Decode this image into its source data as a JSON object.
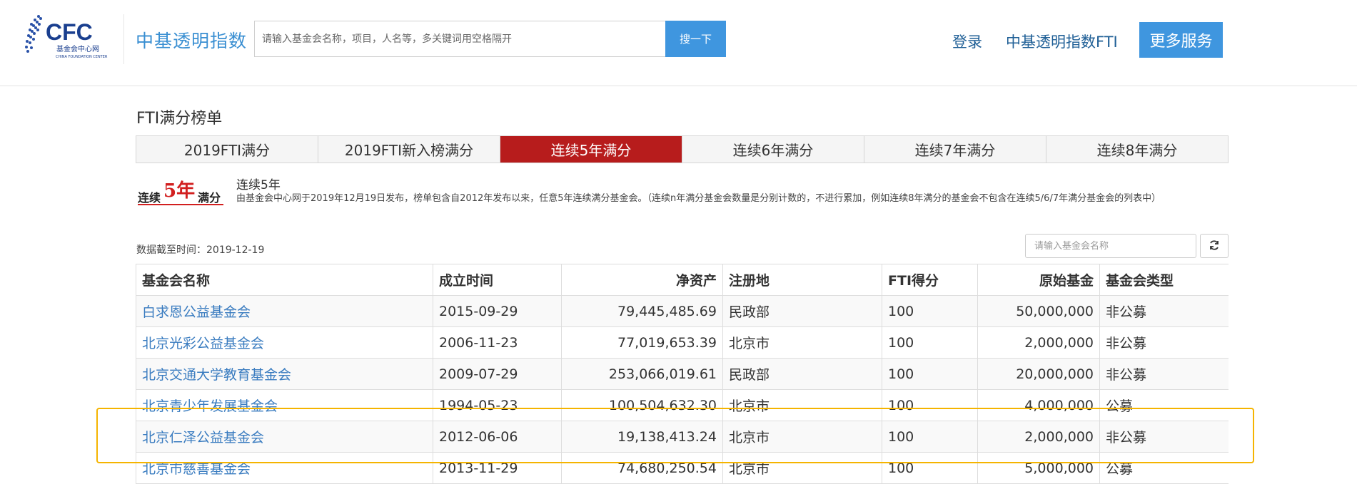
{
  "header": {
    "logo": {
      "main": "CFC",
      "sub_cn": "基金会中心网",
      "sub_en": "CHINA FOUNDATION CENTER",
      "color": "#1a3f8f"
    },
    "brand": "中基透明指数",
    "search": {
      "placeholder": "请输入基金会名称，项目，人名等，多关键词用空格隔开",
      "button": "搜一下"
    },
    "nav": {
      "login": "登录",
      "fti": "中基透明指数FTI",
      "more": "更多服务"
    }
  },
  "main": {
    "section_title": "FTI满分榜单",
    "tabs": [
      {
        "label": "2019FTI满分",
        "active": false
      },
      {
        "label": "2019FTI新入榜满分",
        "active": false
      },
      {
        "label": "连续5年满分",
        "active": true
      },
      {
        "label": "连续6年满分",
        "active": false
      },
      {
        "label": "连续7年满分",
        "active": false
      },
      {
        "label": "连续8年满分",
        "active": false
      }
    ],
    "badge": {
      "pre": "连续",
      "num": "5年",
      "post": "满分"
    },
    "desc_title": "连续5年",
    "desc_text": "由基金会中心网于2019年12月19日发布，榜单包含自2012年发布以来，任意5年连续满分基金会。（连续n年满分基金会数量是分别计数的，不进行累加，例如连续8年满分的基金会不包含在连续5/6/7年满分基金会的列表中）",
    "date_label": "数据截至时间：2019-12-19",
    "filter_placeholder": "请输入基金会名称",
    "table": {
      "headers": [
        "基金会名称",
        "成立时间",
        "净资产",
        "注册地",
        "FTI得分",
        "原始基金",
        "基金会类型"
      ],
      "rows": [
        [
          "白求恩公益基金会",
          "2015-09-29",
          "79,445,485.69",
          "民政部",
          "100",
          "50,000,000",
          "非公募"
        ],
        [
          "北京光彩公益基金会",
          "2006-11-23",
          "77,019,653.39",
          "北京市",
          "100",
          "2,000,000",
          "非公募"
        ],
        [
          "北京交通大学教育基金会",
          "2009-07-29",
          "253,066,019.61",
          "民政部",
          "100",
          "20,000,000",
          "非公募"
        ],
        [
          "北京青少年发展基金会",
          "1994-05-23",
          "100,504,632.30",
          "北京市",
          "100",
          "4,000,000",
          "公募"
        ],
        [
          "北京仁泽公益基金会",
          "2012-06-06",
          "19,138,413.24",
          "北京市",
          "100",
          "2,000,000",
          "非公募"
        ],
        [
          "北京市慈善基金会",
          "2013-11-29",
          "74,680,250.54",
          "北京市",
          "100",
          "5,000,000",
          "公募"
        ]
      ]
    }
  },
  "colors": {
    "accent": "#3f96df",
    "active_tab": "#b71c1c",
    "link": "#3a7cc0",
    "highlight": "#f5b400"
  }
}
